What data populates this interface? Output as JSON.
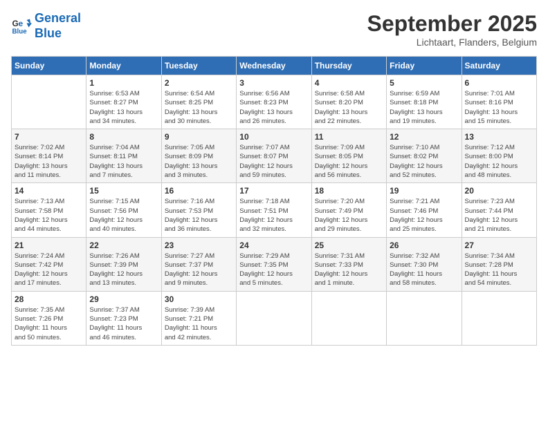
{
  "header": {
    "logo_line1": "General",
    "logo_line2": "Blue",
    "title": "September 2025",
    "subtitle": "Lichtaart, Flanders, Belgium"
  },
  "weekdays": [
    "Sunday",
    "Monday",
    "Tuesday",
    "Wednesday",
    "Thursday",
    "Friday",
    "Saturday"
  ],
  "weeks": [
    [
      {
        "day": "",
        "info": ""
      },
      {
        "day": "1",
        "info": "Sunrise: 6:53 AM\nSunset: 8:27 PM\nDaylight: 13 hours\nand 34 minutes."
      },
      {
        "day": "2",
        "info": "Sunrise: 6:54 AM\nSunset: 8:25 PM\nDaylight: 13 hours\nand 30 minutes."
      },
      {
        "day": "3",
        "info": "Sunrise: 6:56 AM\nSunset: 8:23 PM\nDaylight: 13 hours\nand 26 minutes."
      },
      {
        "day": "4",
        "info": "Sunrise: 6:58 AM\nSunset: 8:20 PM\nDaylight: 13 hours\nand 22 minutes."
      },
      {
        "day": "5",
        "info": "Sunrise: 6:59 AM\nSunset: 8:18 PM\nDaylight: 13 hours\nand 19 minutes."
      },
      {
        "day": "6",
        "info": "Sunrise: 7:01 AM\nSunset: 8:16 PM\nDaylight: 13 hours\nand 15 minutes."
      }
    ],
    [
      {
        "day": "7",
        "info": "Sunrise: 7:02 AM\nSunset: 8:14 PM\nDaylight: 13 hours\nand 11 minutes."
      },
      {
        "day": "8",
        "info": "Sunrise: 7:04 AM\nSunset: 8:11 PM\nDaylight: 13 hours\nand 7 minutes."
      },
      {
        "day": "9",
        "info": "Sunrise: 7:05 AM\nSunset: 8:09 PM\nDaylight: 13 hours\nand 3 minutes."
      },
      {
        "day": "10",
        "info": "Sunrise: 7:07 AM\nSunset: 8:07 PM\nDaylight: 12 hours\nand 59 minutes."
      },
      {
        "day": "11",
        "info": "Sunrise: 7:09 AM\nSunset: 8:05 PM\nDaylight: 12 hours\nand 56 minutes."
      },
      {
        "day": "12",
        "info": "Sunrise: 7:10 AM\nSunset: 8:02 PM\nDaylight: 12 hours\nand 52 minutes."
      },
      {
        "day": "13",
        "info": "Sunrise: 7:12 AM\nSunset: 8:00 PM\nDaylight: 12 hours\nand 48 minutes."
      }
    ],
    [
      {
        "day": "14",
        "info": "Sunrise: 7:13 AM\nSunset: 7:58 PM\nDaylight: 12 hours\nand 44 minutes."
      },
      {
        "day": "15",
        "info": "Sunrise: 7:15 AM\nSunset: 7:56 PM\nDaylight: 12 hours\nand 40 minutes."
      },
      {
        "day": "16",
        "info": "Sunrise: 7:16 AM\nSunset: 7:53 PM\nDaylight: 12 hours\nand 36 minutes."
      },
      {
        "day": "17",
        "info": "Sunrise: 7:18 AM\nSunset: 7:51 PM\nDaylight: 12 hours\nand 32 minutes."
      },
      {
        "day": "18",
        "info": "Sunrise: 7:20 AM\nSunset: 7:49 PM\nDaylight: 12 hours\nand 29 minutes."
      },
      {
        "day": "19",
        "info": "Sunrise: 7:21 AM\nSunset: 7:46 PM\nDaylight: 12 hours\nand 25 minutes."
      },
      {
        "day": "20",
        "info": "Sunrise: 7:23 AM\nSunset: 7:44 PM\nDaylight: 12 hours\nand 21 minutes."
      }
    ],
    [
      {
        "day": "21",
        "info": "Sunrise: 7:24 AM\nSunset: 7:42 PM\nDaylight: 12 hours\nand 17 minutes."
      },
      {
        "day": "22",
        "info": "Sunrise: 7:26 AM\nSunset: 7:39 PM\nDaylight: 12 hours\nand 13 minutes."
      },
      {
        "day": "23",
        "info": "Sunrise: 7:27 AM\nSunset: 7:37 PM\nDaylight: 12 hours\nand 9 minutes."
      },
      {
        "day": "24",
        "info": "Sunrise: 7:29 AM\nSunset: 7:35 PM\nDaylight: 12 hours\nand 5 minutes."
      },
      {
        "day": "25",
        "info": "Sunrise: 7:31 AM\nSunset: 7:33 PM\nDaylight: 12 hours\nand 1 minute."
      },
      {
        "day": "26",
        "info": "Sunrise: 7:32 AM\nSunset: 7:30 PM\nDaylight: 11 hours\nand 58 minutes."
      },
      {
        "day": "27",
        "info": "Sunrise: 7:34 AM\nSunset: 7:28 PM\nDaylight: 11 hours\nand 54 minutes."
      }
    ],
    [
      {
        "day": "28",
        "info": "Sunrise: 7:35 AM\nSunset: 7:26 PM\nDaylight: 11 hours\nand 50 minutes."
      },
      {
        "day": "29",
        "info": "Sunrise: 7:37 AM\nSunset: 7:23 PM\nDaylight: 11 hours\nand 46 minutes."
      },
      {
        "day": "30",
        "info": "Sunrise: 7:39 AM\nSunset: 7:21 PM\nDaylight: 11 hours\nand 42 minutes."
      },
      {
        "day": "",
        "info": ""
      },
      {
        "day": "",
        "info": ""
      },
      {
        "day": "",
        "info": ""
      },
      {
        "day": "",
        "info": ""
      }
    ]
  ]
}
